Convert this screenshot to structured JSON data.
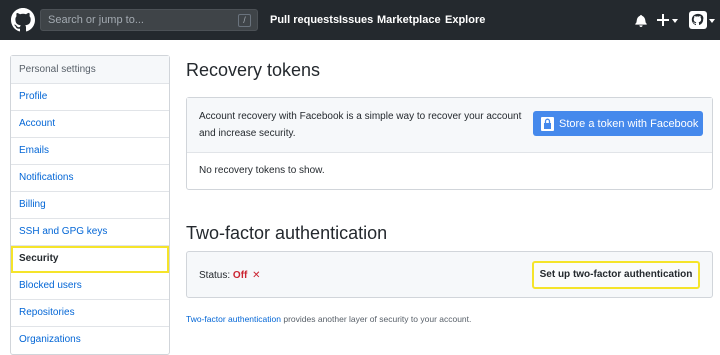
{
  "header": {
    "search_placeholder": "Search or jump to...",
    "search_shortcut": "/",
    "nav": [
      "Pull requests",
      "Issues",
      "Marketplace",
      "Explore"
    ],
    "icons": [
      "github-logo",
      "bell-icon",
      "plus-icon",
      "caret-down-icon",
      "avatar"
    ]
  },
  "sidebar": {
    "heading": "Personal settings",
    "items": [
      {
        "label": "Profile"
      },
      {
        "label": "Account"
      },
      {
        "label": "Emails"
      },
      {
        "label": "Notifications"
      },
      {
        "label": "Billing"
      },
      {
        "label": "SSH and GPG keys"
      },
      {
        "label": "Security",
        "active": true
      },
      {
        "label": "Blocked users"
      },
      {
        "label": "Repositories"
      },
      {
        "label": "Organizations"
      }
    ]
  },
  "recovery": {
    "title": "Recovery tokens",
    "description": "Account recovery with Facebook is a simple way to recover your account and increase security.",
    "button_label": "Store a token with Facebook",
    "empty_text": "No recovery tokens to show."
  },
  "two_factor": {
    "title": "Two-factor authentication",
    "status_label": "Status:",
    "status_value": "Off",
    "status_mark": "✕",
    "setup_button": "Set up two-factor authentication",
    "note_link": "Two-factor authentication",
    "note_text": " provides another layer of security to your account."
  },
  "colors": {
    "header_bg": "#24292e",
    "link": "#0366d6",
    "highlight": "#f5e42a",
    "facebook_button": "#4589ec",
    "status_off": "#cb2431"
  }
}
